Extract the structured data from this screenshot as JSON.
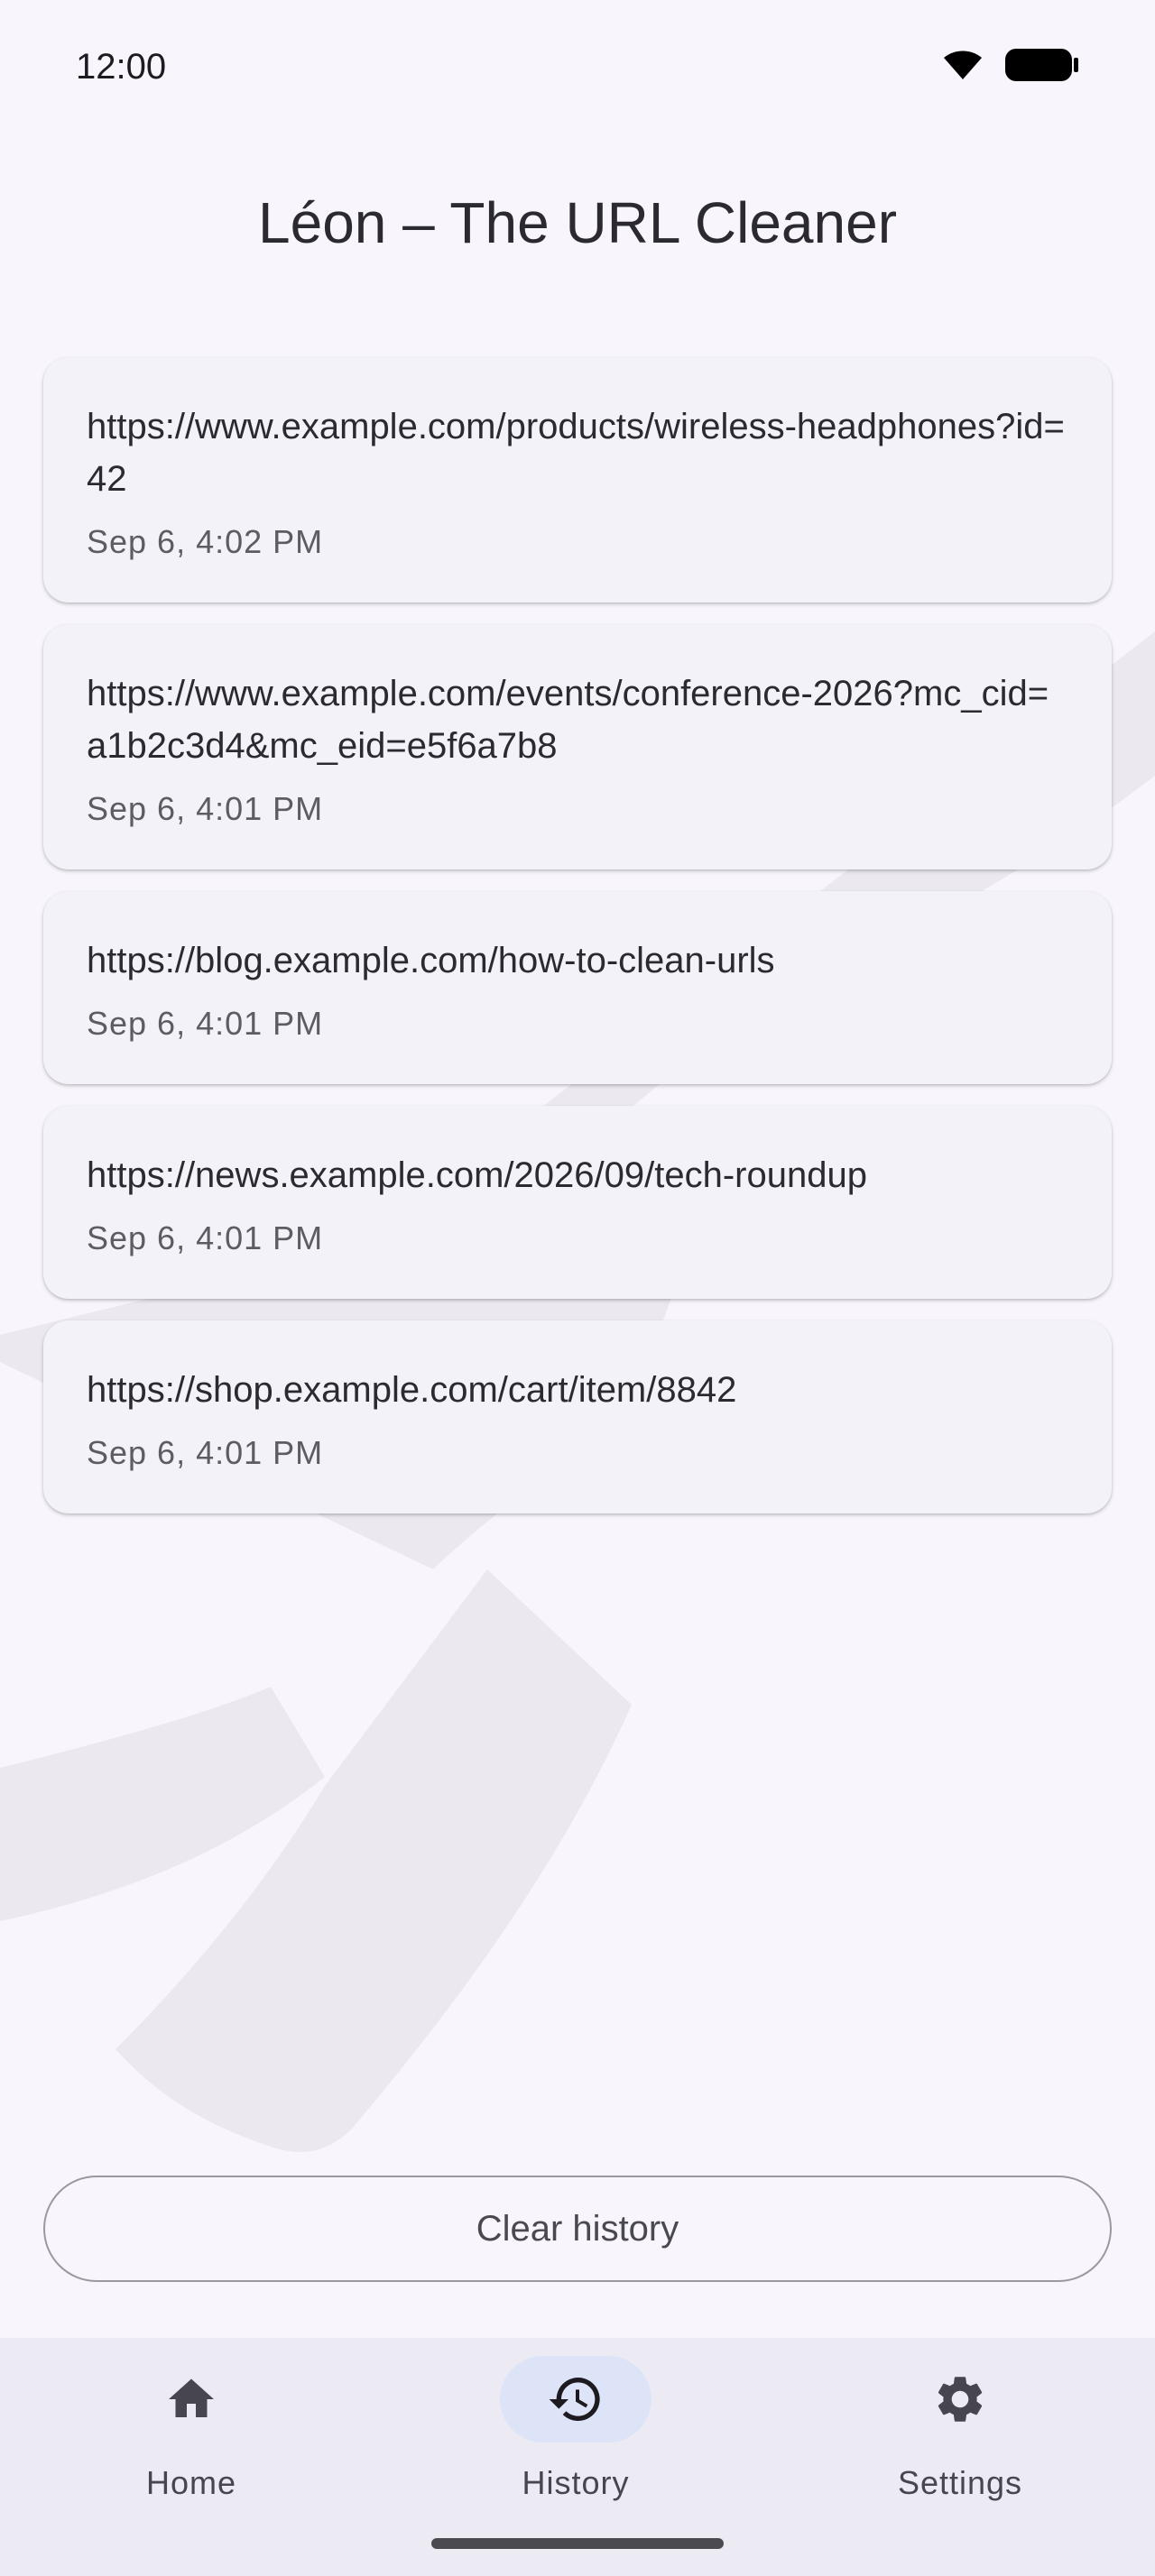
{
  "status_bar": {
    "time": "12:00",
    "wifi_icon": "wifi-icon",
    "battery_icon": "battery-icon"
  },
  "app": {
    "title": "Léon – The URL Cleaner"
  },
  "history": [
    {
      "url": "https://www.example.com/products/wireless-headphones?id=42",
      "time": "Sep 6, 4:02 PM"
    },
    {
      "url": "https://www.example.com/events/conference-2026?mc_cid=a1b2c3d4&mc_eid=e5f6a7b8",
      "time": "Sep 6, 4:01 PM"
    },
    {
      "url": "https://blog.example.com/how-to-clean-urls",
      "time": "Sep 6, 4:01 PM"
    },
    {
      "url": "https://news.example.com/2026/09/tech-roundup",
      "time": "Sep 6, 4:01 PM"
    },
    {
      "url": "https://shop.example.com/cart/item/8842",
      "time": "Sep 6, 4:01 PM"
    }
  ],
  "actions": {
    "clear_history": "Clear history"
  },
  "bottom_nav": {
    "items": [
      {
        "label": "Home",
        "icon": "home-icon",
        "active": false
      },
      {
        "label": "History",
        "icon": "history-icon",
        "active": true
      },
      {
        "label": "Settings",
        "icon": "gear-icon",
        "active": false
      }
    ]
  },
  "colors": {
    "background": "#f8f6fc",
    "card": "#f2f2f8",
    "nav_background": "#ecebf3",
    "active_pill": "#dde4f8"
  }
}
